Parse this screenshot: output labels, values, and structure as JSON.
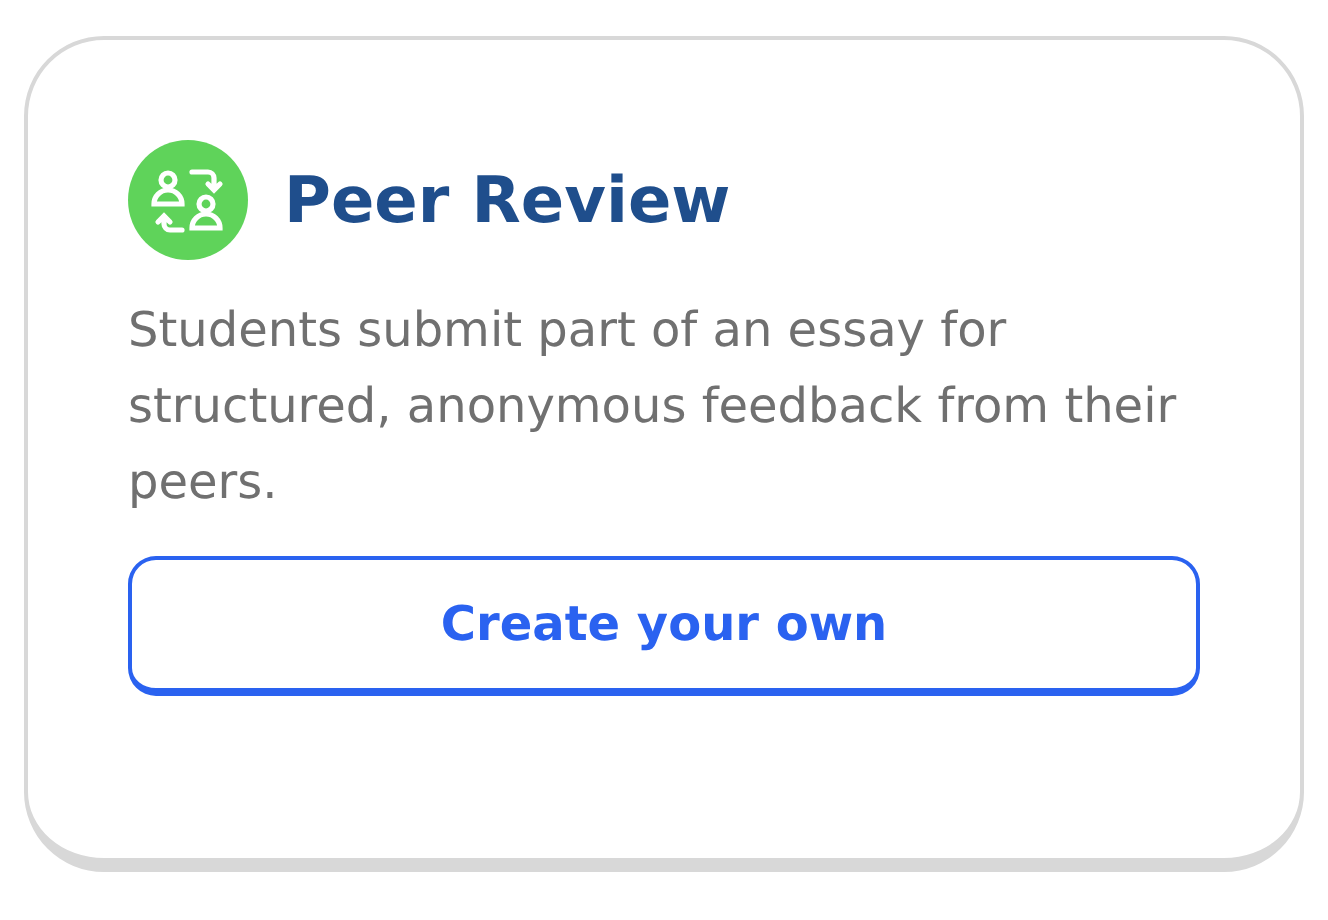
{
  "card": {
    "title": "Peer Review",
    "description": "Students submit part of an essay for structured, anonymous feedback from their peers.",
    "button": "Create your own"
  }
}
